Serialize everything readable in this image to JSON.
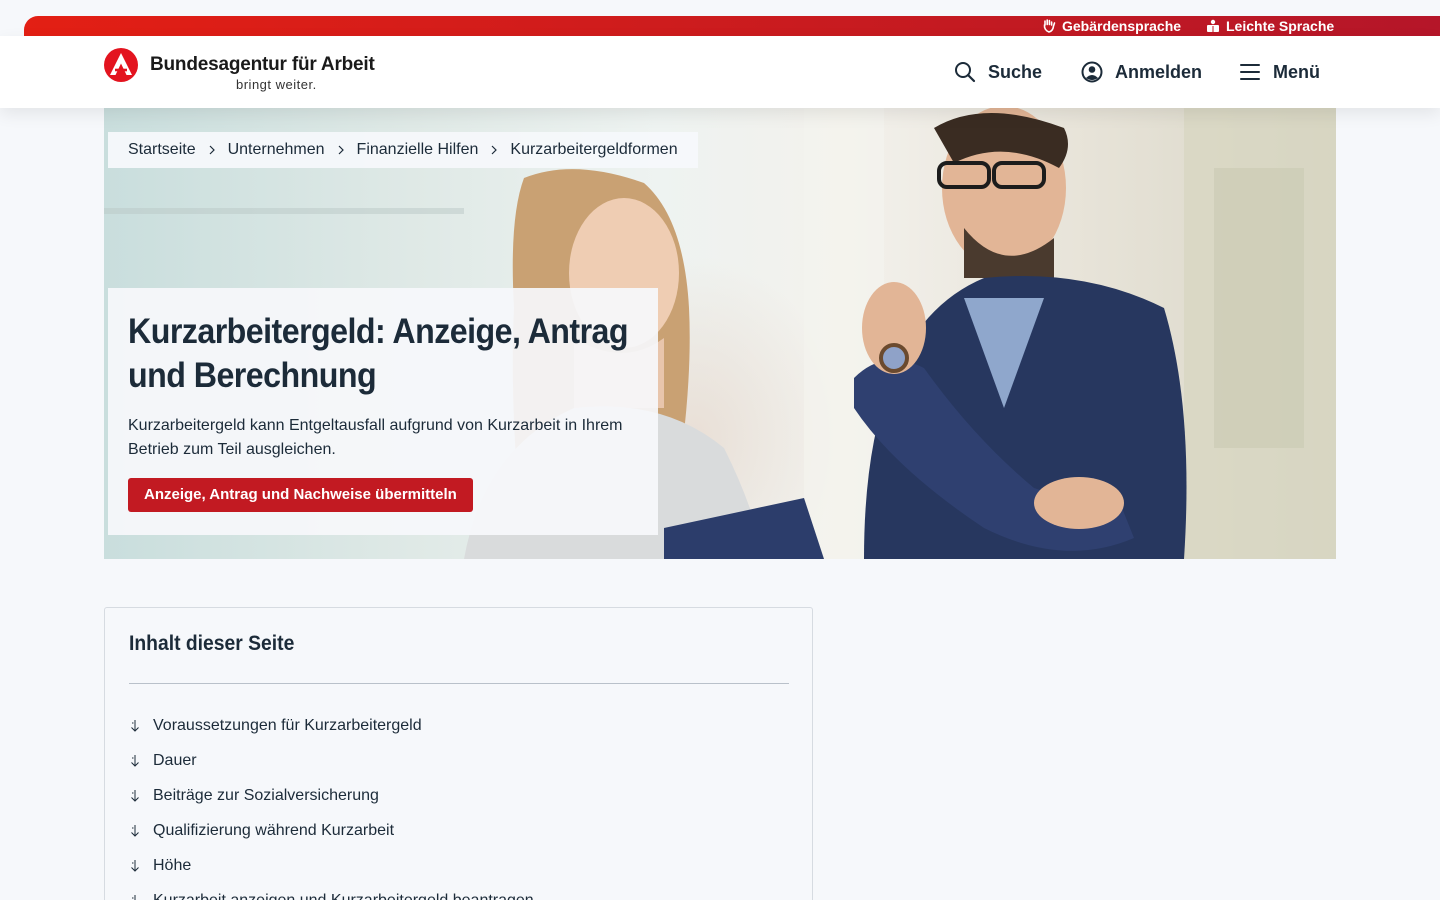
{
  "topbar": {
    "sign_language": "Gebärdensprache",
    "easy_language": "Leichte Sprache"
  },
  "header": {
    "logo_name": "Bundesagentur für Arbeit",
    "logo_claim": "bringt weiter.",
    "search_label": "Suche",
    "login_label": "Anmelden",
    "menu_label": "Menü"
  },
  "breadcrumb": [
    "Startseite",
    "Unternehmen",
    "Finanzielle Hilfen",
    "Kurzarbeitergeldformen"
  ],
  "hero": {
    "title_line1": "Kurzarbeitergeld: Anzeige, Antrag",
    "title_line2": "und Berechnung",
    "text": "Kurzarbeitergeld kann Entgeltausfall aufgrund von Kurzarbeit in Ihrem Betrieb zum Teil ausgleichen.",
    "button_label": "Anzeige, Antrag und Nachweise übermitteln"
  },
  "toc": {
    "title": "Inhalt dieser Seite",
    "items": [
      "Voraussetzungen für Kurzarbeitergeld",
      "Dauer",
      "Beiträge zur Sozialversicherung",
      "Qualifizierung während Kurzarbeit",
      "Höhe",
      "Kurzarbeit anzeigen und Kurzarbeitergeld beantragen"
    ]
  },
  "colors": {
    "brand_red": "#c21a22",
    "text_dark": "#1c2b39",
    "page_bg": "#f6f8fb"
  },
  "icons": [
    "sign-language-icon",
    "easy-language-icon",
    "search-icon",
    "user-icon",
    "menu-icon",
    "chevron-right-icon",
    "arrow-down-icon"
  ]
}
